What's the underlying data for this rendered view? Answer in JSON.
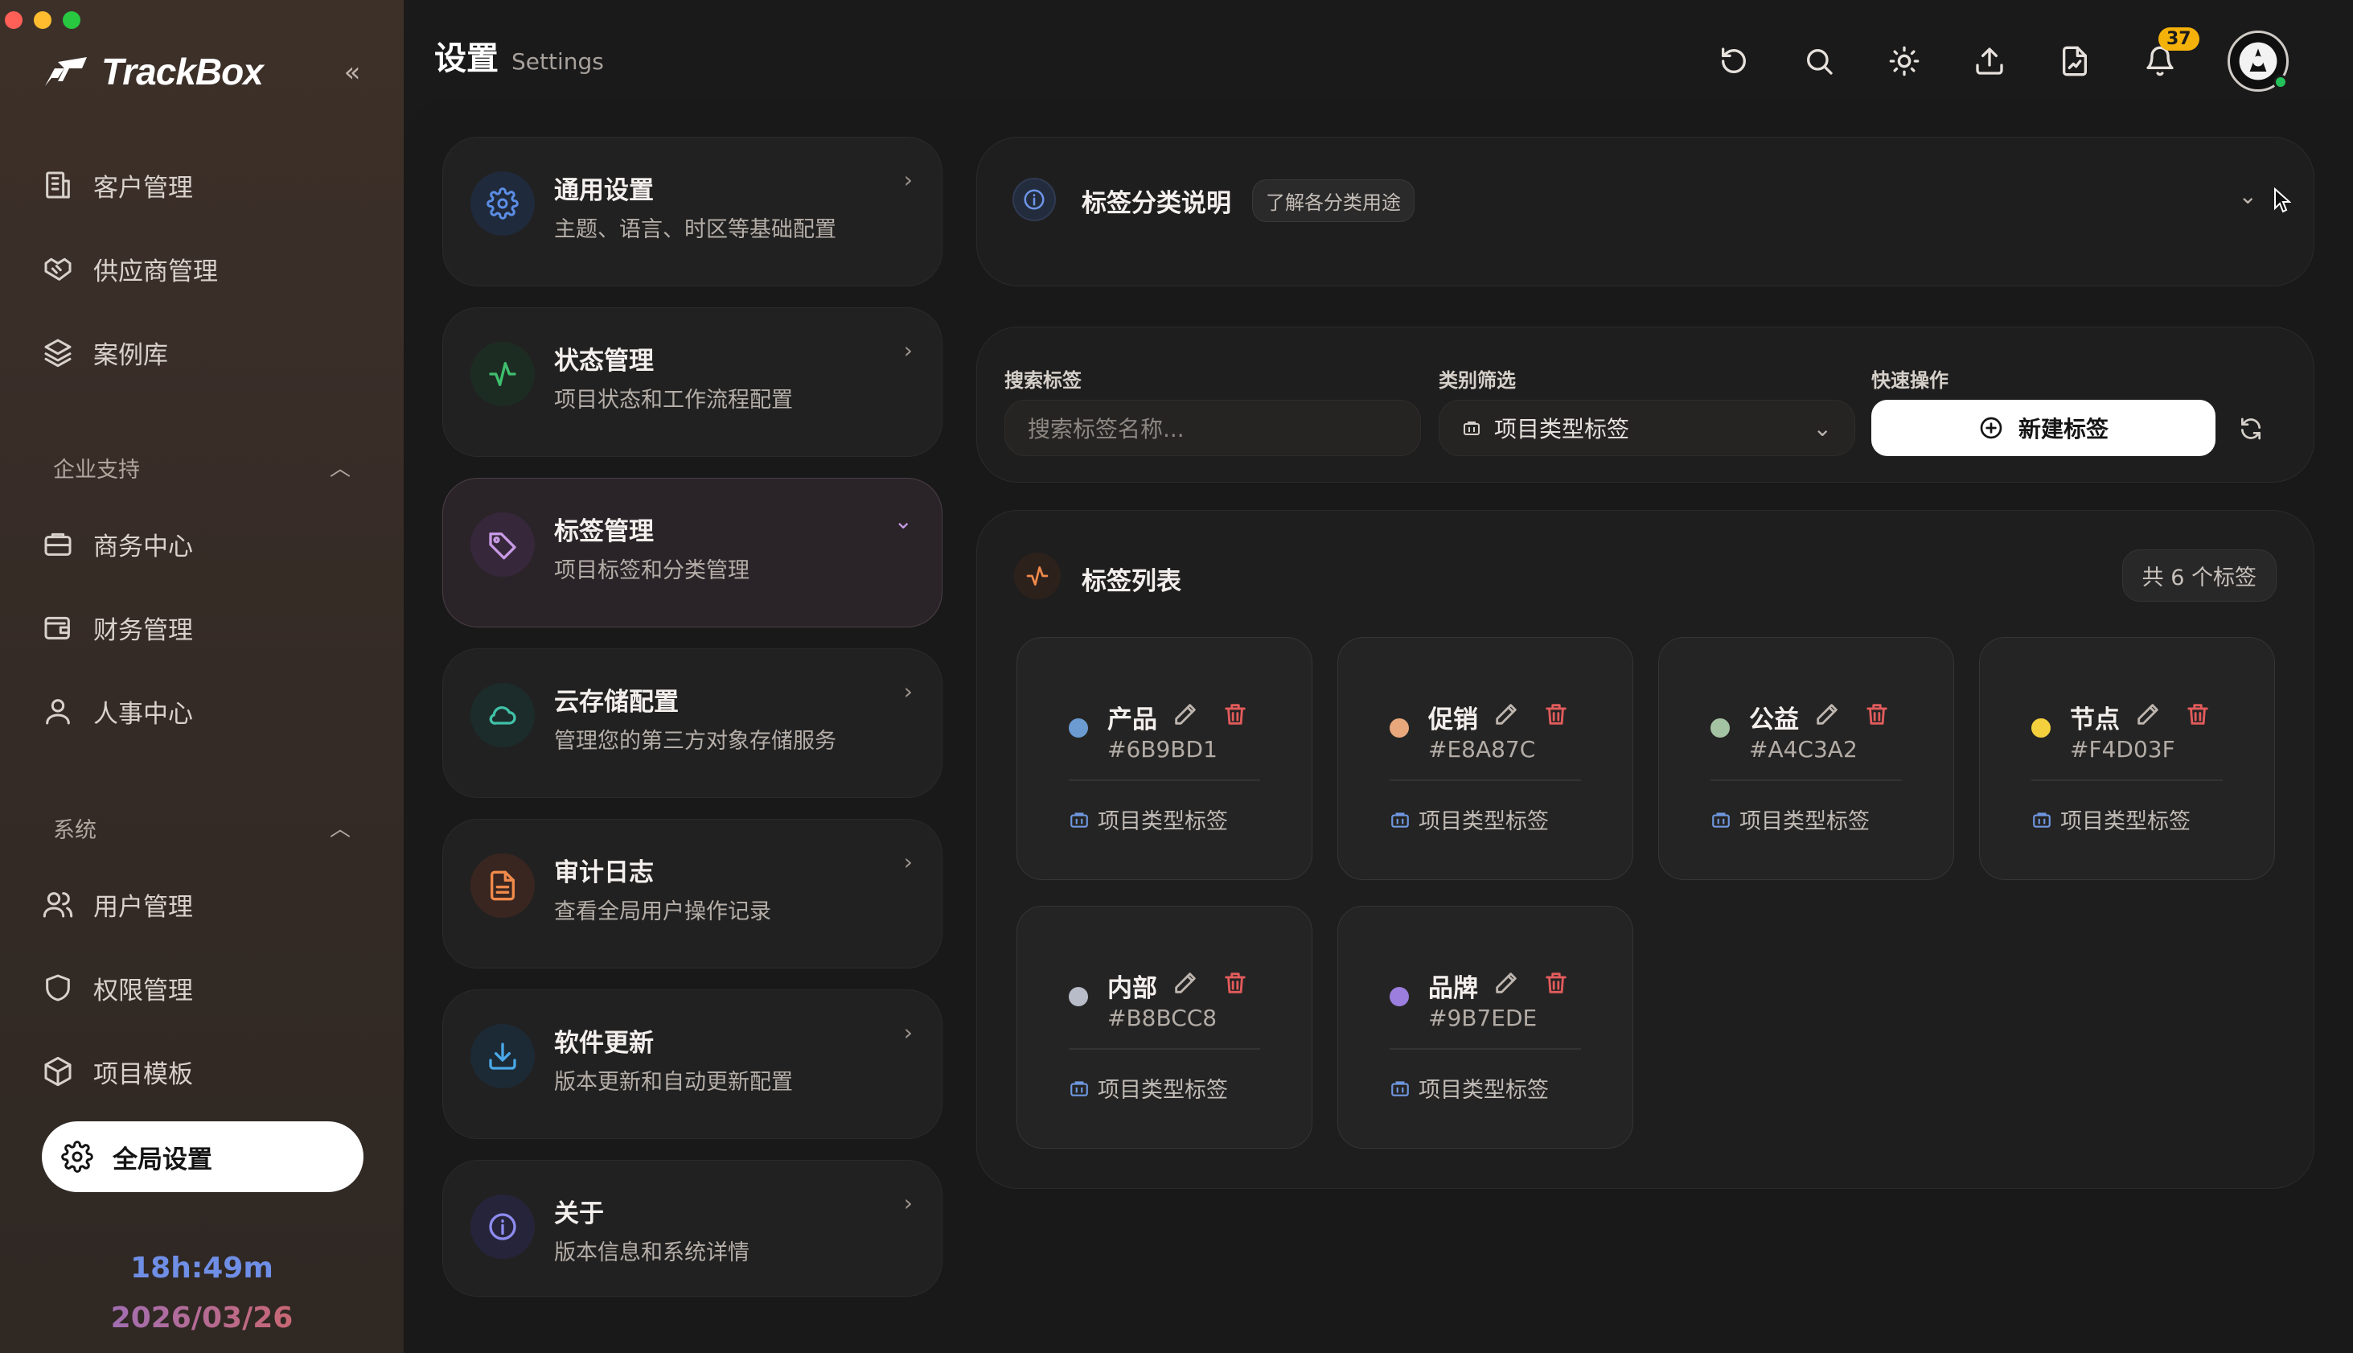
{
  "window": {
    "traffic_lights": [
      "#fe5f57",
      "#febc2e",
      "#28c840"
    ]
  },
  "sidebar": {
    "brand": "TrackBox",
    "items_top": [
      {
        "label": "客户管理",
        "icon": "building-icon"
      },
      {
        "label": "供应商管理",
        "icon": "handshake-icon"
      },
      {
        "label": "案例库",
        "icon": "layers-icon"
      }
    ],
    "group_enterprise": "企业支持",
    "items_enterprise": [
      {
        "label": "商务中心",
        "icon": "briefcase-icon"
      },
      {
        "label": "财务管理",
        "icon": "wallet-icon"
      },
      {
        "label": "人事中心",
        "icon": "user-icon"
      }
    ],
    "group_system": "系统",
    "items_system": [
      {
        "label": "用户管理",
        "icon": "users-icon"
      },
      {
        "label": "权限管理",
        "icon": "shield-icon"
      },
      {
        "label": "项目模板",
        "icon": "box-icon"
      }
    ],
    "active_item": {
      "label": "全局设置",
      "icon": "gear-icon"
    },
    "clock_time": "18h:49m",
    "clock_date": "2026/03/26"
  },
  "topbar": {
    "title": "设置",
    "subtitle": "Settings",
    "notification_count": "37",
    "icons": [
      "refresh-icon",
      "search-icon",
      "sun-icon",
      "upload-icon",
      "file-sign-icon",
      "bell-icon"
    ]
  },
  "settings_menu": [
    {
      "title": "通用设置",
      "desc": "主题、语言、时区等基础配置",
      "icon": "gear-icon",
      "color": "#5b8ee6",
      "bg": "#1f2a3c"
    },
    {
      "title": "状态管理",
      "desc": "项目状态和工作流程配置",
      "icon": "activity-icon",
      "color": "#3fbf6e",
      "bg": "#1d2c23"
    },
    {
      "title": "标签管理",
      "desc": "项目标签和分类管理",
      "icon": "tag-icon",
      "color": "#c79ae4",
      "bg": "#37273b"
    },
    {
      "title": "云存储配置",
      "desc": "管理您的第三方对象存储服务",
      "icon": "cloud-icon",
      "color": "#41c1a8",
      "bg": "#1b2c2a"
    },
    {
      "title": "审计日志",
      "desc": "查看全局用户操作记录",
      "icon": "file-text-icon",
      "color": "#f08a4b",
      "bg": "#3a2620"
    },
    {
      "title": "软件更新",
      "desc": "版本更新和自动更新配置",
      "icon": "download-icon",
      "color": "#4aa8e8",
      "bg": "#1c2a36"
    },
    {
      "title": "关于",
      "desc": "版本信息和系统详情",
      "icon": "info-icon",
      "color": "#8d8cf0",
      "bg": "#26243a"
    }
  ],
  "info_panel": {
    "title": "标签分类说明",
    "pill": "了解各分类用途"
  },
  "filters": {
    "search_label": "搜索标签",
    "search_placeholder": "搜索标签名称...",
    "category_label": "类别筛选",
    "category_value": "项目类型标签",
    "quick_label": "快速操作",
    "new_button": "新建标签"
  },
  "tag_list": {
    "title": "标签列表",
    "count_text": "共 6 个标签",
    "tags": [
      {
        "name": "产品",
        "hex": "#6B9BD1",
        "category": "项目类型标签"
      },
      {
        "name": "促销",
        "hex": "#E8A87C",
        "category": "项目类型标签"
      },
      {
        "name": "公益",
        "hex": "#A4C3A2",
        "category": "项目类型标签"
      },
      {
        "name": "节点",
        "hex": "#F4D03F",
        "category": "项目类型标签"
      },
      {
        "name": "内部",
        "hex": "#B8BCC8",
        "category": "项目类型标签"
      },
      {
        "name": "品牌",
        "hex": "#9B7EDE",
        "category": "项目类型标签"
      }
    ]
  }
}
